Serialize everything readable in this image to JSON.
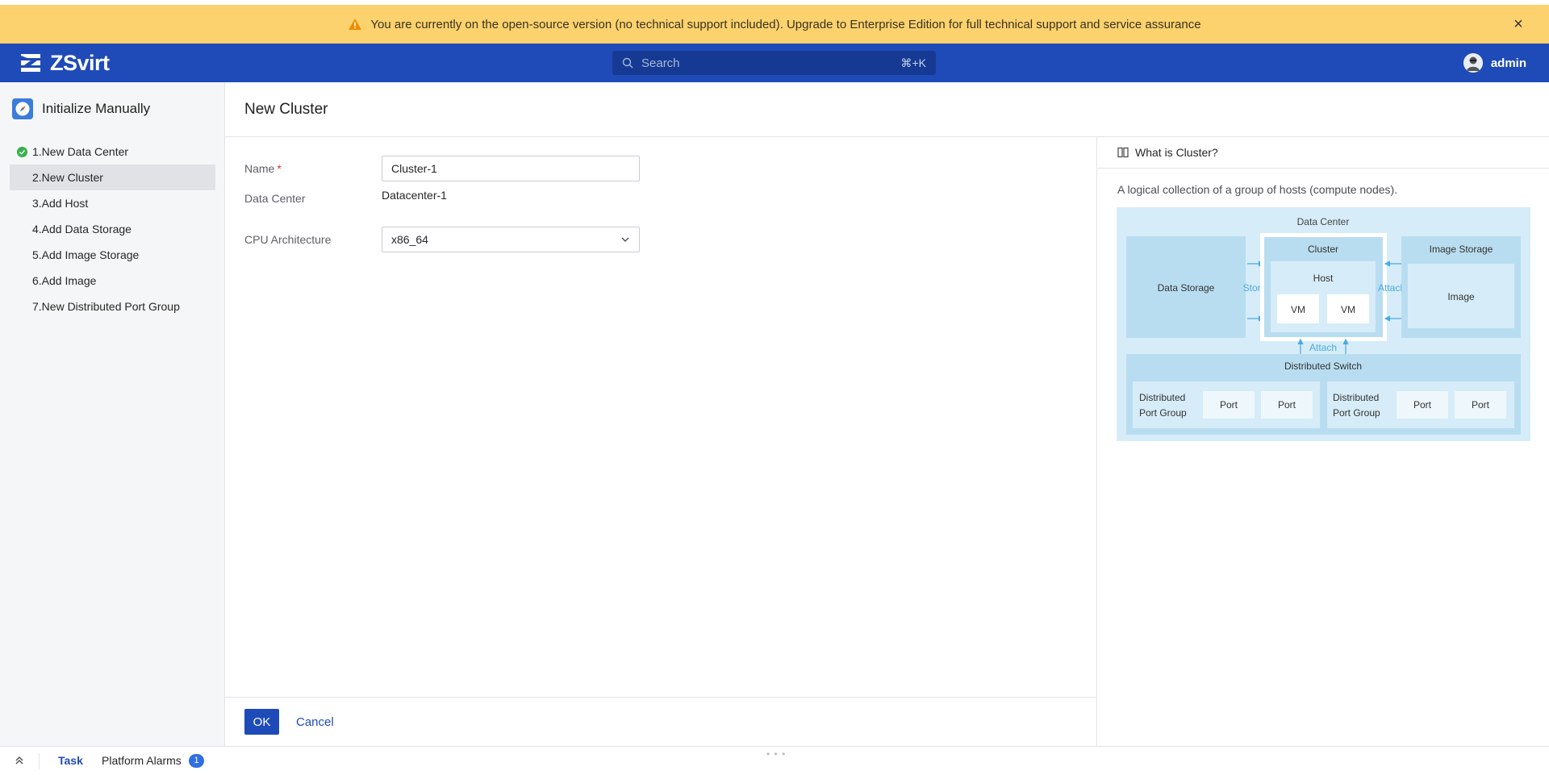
{
  "banner": {
    "message": "You are currently on the open-source version (no technical support included). Upgrade to Enterprise Edition for full technical support and service assurance",
    "icon": "warning-icon",
    "close_icon": "close-icon"
  },
  "header": {
    "brand": "ZSvirt",
    "search_placeholder": "Search",
    "search_shortcut": "⌘+K",
    "user_name": "admin"
  },
  "sidebar": {
    "title": "Initialize Manually",
    "steps": [
      {
        "label": "1.New Data Center",
        "status": "done"
      },
      {
        "label": "2.New Cluster",
        "status": "active"
      },
      {
        "label": "3.Add Host",
        "status": "pending"
      },
      {
        "label": "4.Add Data Storage",
        "status": "pending"
      },
      {
        "label": "5.Add Image Storage",
        "status": "pending"
      },
      {
        "label": "6.Add Image",
        "status": "pending"
      },
      {
        "label": "7.New Distributed Port Group",
        "status": "pending"
      }
    ]
  },
  "main": {
    "title": "New Cluster",
    "form": {
      "name_label": "Name",
      "name_required": "*",
      "name_value": "Cluster-1",
      "datacenter_label": "Data Center",
      "datacenter_value": "Datacenter-1",
      "cpu_label": "CPU Architecture",
      "cpu_value": "x86_64"
    },
    "ok_label": "OK",
    "cancel_label": "Cancel"
  },
  "help": {
    "title": "What is Cluster?",
    "description": "A logical collection of a group of hosts (compute nodes).",
    "diagram": {
      "data_center": "Data Center",
      "data_storage": "Data Storage",
      "store": "Store",
      "cluster": "Cluster",
      "host": "Host",
      "vm1": "VM",
      "vm2": "VM",
      "attach_right": "Attach",
      "image_storage": "Image Storage",
      "image": "Image",
      "attach_bottom": "Attach",
      "distributed_switch": "Distributed Switch",
      "port_group_line1": "Distributed",
      "port_group_line2": "Port Group",
      "port": "Port"
    }
  },
  "bottom_bar": {
    "task_label": "Task",
    "alarms_label": "Platform Alarms",
    "alarms_count": "1"
  },
  "colors": {
    "banner": "#fcd26e",
    "header": "#1f4bb8",
    "primary": "#1f4bb8",
    "success": "#37b24d"
  }
}
